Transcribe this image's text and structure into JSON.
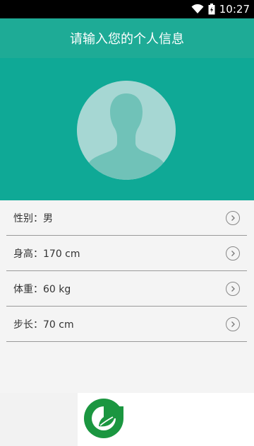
{
  "status_bar": {
    "time": "10:27",
    "icons": [
      "wifi-icon",
      "battery-icon"
    ]
  },
  "app_bar": {
    "title": "请输入您的个人信息"
  },
  "profile": {
    "avatar_icon": "default-user-avatar-icon"
  },
  "info_list": [
    {
      "label": "性别：男"
    },
    {
      "label": "身高：170 cm"
    },
    {
      "label": "体重：60 kg"
    },
    {
      "label": "步长：70 cm"
    }
  ],
  "colors": {
    "primary": "#1eab96",
    "header": "#0fa996",
    "avatar_bg": "#a6d7d3",
    "logo_green": "#1b9640"
  },
  "logo": {
    "icon": "app-leaf-logo-icon"
  }
}
